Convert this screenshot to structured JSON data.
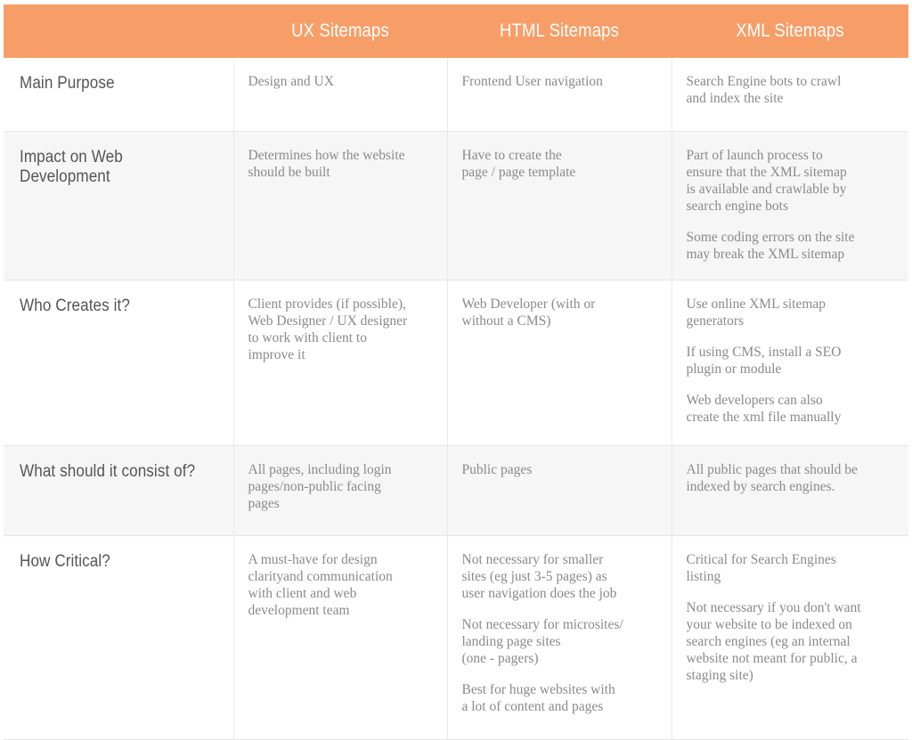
{
  "table": {
    "header": {
      "corner_label": "",
      "columns": [
        {
          "key": "ux",
          "label": "UX Sitemaps"
        },
        {
          "key": "html",
          "label": "HTML Sitemaps"
        },
        {
          "key": "xml",
          "label": "XML Sitemaps"
        }
      ]
    },
    "rows": [
      {
        "label": "Main Purpose",
        "ux": [
          "Design and UX"
        ],
        "html": [
          "Frontend User navigation"
        ],
        "xml": [
          "Search Engine bots to crawl\nand index the site"
        ]
      },
      {
        "label": "Impact on Web Development",
        "ux": [
          "Determines how the website\nshould be built"
        ],
        "html": [
          "Have to create the\npage / page template"
        ],
        "xml": [
          "Part of launch process to\nensure that the XML sitemap\nis available and crawlable by\nsearch engine bots",
          "Some coding errors on the site\nmay break the XML sitemap"
        ]
      },
      {
        "label": "Who Creates it?",
        "ux": [
          "Client provides (if possible),\nWeb Designer / UX designer\nto work with client to\nimprove it"
        ],
        "html": [
          "Web Developer (with or\nwithout a CMS)"
        ],
        "xml": [
          "Use online XML sitemap\ngenerators",
          "If using CMS, install a SEO\nplugin or module",
          "Web developers can also\ncreate the xml file manually"
        ]
      },
      {
        "label": "What should it consist of?",
        "ux": [
          "All pages, including login\npages/non-public facing\npages"
        ],
        "html": [
          "Public pages"
        ],
        "xml": [
          "All public pages that should be\nindexed by search engines."
        ]
      },
      {
        "label": "How Critical?",
        "ux": [
          "A must-have for design\nclarityand communication\nwith  client and web\ndevelopment team"
        ],
        "html": [
          "Not necessary for smaller\nsites (eg just 3-5 pages) as\nuser navigation does the job",
          "Not necessary for microsites/\nlanding page sites\n(one - pagers)",
          "Best for huge websites with\na lot of content and pages"
        ],
        "xml": [
          "Critical for Search Engines\nlisting",
          "Not necessary if you don't want\nyour website to be indexed on\nsearch engines (eg an internal\nwebsite not meant for public, a\nstaging site)"
        ]
      }
    ]
  },
  "colors": {
    "header_background": "#f79e68",
    "header_text": "#ffffff",
    "row_label_text": "#555555",
    "cell_text": "#8a8a8a",
    "stripe_background": "#f6f6f6",
    "grid_line": "#e9e9e9"
  }
}
